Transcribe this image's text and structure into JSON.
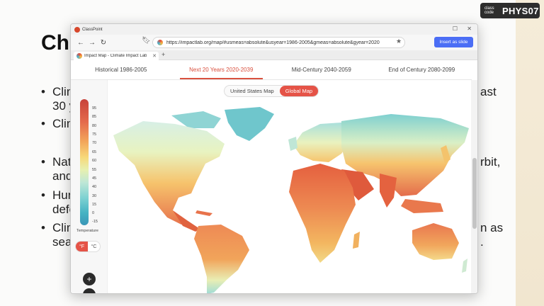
{
  "slide": {
    "title": "Ch",
    "bullets": [
      "Clim",
      "30 y",
      "Clim",
      "Natu",
      "and",
      "Hun",
      "defo",
      "Clim",
      "sea"
    ],
    "right_fragments": [
      "ast",
      "rbit,",
      "n as",
      "."
    ],
    "class_code_label": "class code",
    "class_code": "PHYS07"
  },
  "window": {
    "app_name": "ClassPoint",
    "url": "https://impactlab.org/map/#usmeas=absolute&usyear=1986-2005&gmeas=absolute&gyear=2020",
    "insert_label": "Insert as slide",
    "tab_title": "Impact Map - Climate Impact Lab",
    "tab_close": "✕",
    "new_tab": "+"
  },
  "periods": [
    {
      "label": "Historical 1986-2005",
      "active": false
    },
    {
      "label": "Next 20 Years 2020-2039",
      "active": true
    },
    {
      "label": "Mid-Century 2040-2059",
      "active": false
    },
    {
      "label": "End of Century 2080-2099",
      "active": false
    }
  ],
  "map_toggle": {
    "us": "United States Map",
    "global": "Global Map"
  },
  "legend": {
    "ticks": [
      "95",
      "85",
      "80",
      "75",
      "70",
      "65",
      "60",
      "55",
      "45",
      "40",
      "30",
      "15",
      "0",
      "-15"
    ],
    "title": "Temperature",
    "units": [
      "°F",
      "°C"
    ]
  },
  "zoom": {
    "in": "+"
  },
  "colors": {
    "accent": "#e55347",
    "insert": "#4b6ef5"
  }
}
